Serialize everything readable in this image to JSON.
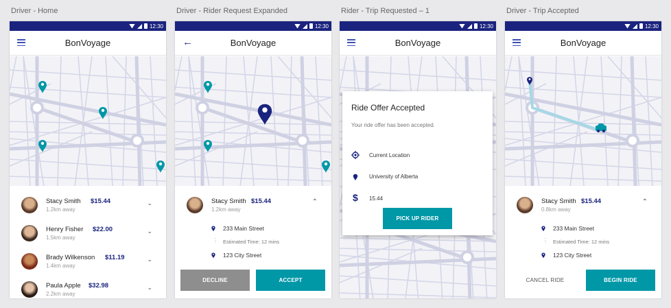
{
  "artboards": [
    "Driver - Home",
    "Driver - Rider Request Expanded",
    "Rider - Trip Requested – 1",
    "Driver - Trip Accepted"
  ],
  "status_time": "12:30",
  "app_title": "BonVoyage",
  "riders": [
    {
      "name": "Stacy Smith",
      "distance": "1.2km away",
      "price": "$15.44"
    },
    {
      "name": "Henry Fisher",
      "distance": "1.5km away",
      "price": "$22.00"
    },
    {
      "name": "Brady Wilkenson",
      "distance": "1.4km away",
      "price": "$11.19"
    },
    {
      "name": "Paula Apple",
      "distance": "2.2km away",
      "price": "$32.98"
    }
  ],
  "request": {
    "name": "Stacy Smith",
    "distance": "1.2km away",
    "price": "$15.44",
    "pickup": "233 Main Street",
    "estimated": "Estimated Time: 12 mins",
    "dropoff": "123 City Street",
    "decline": "DECLINE",
    "accept": "ACCEPT"
  },
  "dialog": {
    "title": "Ride Offer Accepted",
    "message": "Your ride offer has been accepted.",
    "current_location": "Current Location",
    "destination": "University of Alberta",
    "fare": "15.44",
    "button": "PICK UP RIDER"
  },
  "accepted": {
    "name": "Stacy Smith",
    "distance": "0.8km away",
    "price": "$15.44",
    "pickup": "233 Main Street",
    "estimated": "Estimated Time: 12 mins",
    "dropoff": "123 City Street",
    "cancel": "CANCEL RIDE",
    "begin": "BEGIN RIDE"
  },
  "colors": {
    "primary": "#1a237e",
    "accent": "#0097a7",
    "grey": "#8e8e8e"
  }
}
